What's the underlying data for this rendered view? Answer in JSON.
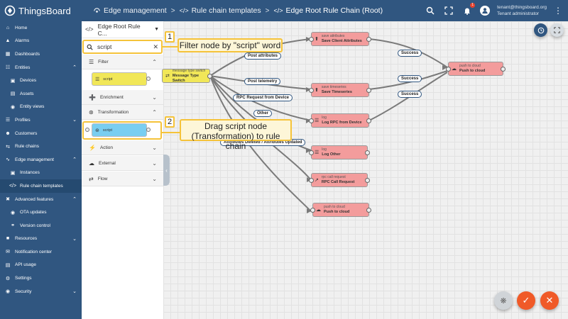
{
  "header": {
    "app_name": "ThingsBoard",
    "breadcrumbs": [
      {
        "label": "Edge management"
      },
      {
        "label": "Rule chain templates"
      },
      {
        "label": "Edge Root Rule Chain (Root)"
      }
    ],
    "notification_count": "1",
    "user_email": "tenant@thingsboard.org",
    "user_role": "Tenant administrator"
  },
  "sidebar": {
    "items": [
      {
        "label": "Home",
        "icon": "home-icon"
      },
      {
        "label": "Alarms",
        "icon": "alarm-icon"
      },
      {
        "label": "Dashboards",
        "icon": "dashboard-icon"
      },
      {
        "label": "Entities",
        "icon": "entities-icon",
        "expanded": true
      },
      {
        "label": "Devices",
        "icon": "device-icon",
        "sub": true
      },
      {
        "label": "Assets",
        "icon": "asset-icon",
        "sub": true
      },
      {
        "label": "Entity views",
        "icon": "entity-view-icon",
        "sub": true
      },
      {
        "label": "Profiles",
        "icon": "profile-icon"
      },
      {
        "label": "Customers",
        "icon": "customers-icon"
      },
      {
        "label": "Rule chains",
        "icon": "rule-chain-icon"
      },
      {
        "label": "Edge management",
        "icon": "edge-icon",
        "expanded": true
      },
      {
        "label": "Instances",
        "icon": "instances-icon",
        "sub": true
      },
      {
        "label": "Rule chain templates",
        "icon": "template-icon",
        "sub": true,
        "active": true
      },
      {
        "label": "Advanced features",
        "icon": "advanced-icon",
        "expanded": true
      },
      {
        "label": "OTA updates",
        "icon": "ota-icon",
        "sub": true
      },
      {
        "label": "Version control",
        "icon": "version-control-icon",
        "sub": true
      },
      {
        "label": "Resources",
        "icon": "resources-icon"
      },
      {
        "label": "Notification center",
        "icon": "notification-icon"
      },
      {
        "label": "API usage",
        "icon": "api-usage-icon"
      },
      {
        "label": "Settings",
        "icon": "settings-icon"
      },
      {
        "label": "Security",
        "icon": "security-icon"
      }
    ]
  },
  "library": {
    "rule_chain_select": "Edge Root Rule C...",
    "search_value": "script",
    "categories": {
      "filter": "Filter",
      "enrichment": "Enrichment",
      "transformation": "Transformation",
      "action": "Action",
      "external": "External",
      "flow": "Flow"
    },
    "filter_node": "script",
    "transformation_node": "script"
  },
  "callouts": {
    "one_number": "1",
    "one_text": "Filter node by \"script\" word",
    "two_number": "2",
    "two_text": "Drag script node (Transformation) to rule chain"
  },
  "canvas": {
    "nodes": {
      "switch": {
        "type": "message type switch",
        "name": "Message Type Switch"
      },
      "save_attr": {
        "type": "save attributes",
        "name": "Save Client Attributes"
      },
      "save_ts": {
        "type": "save timeseries",
        "name": "Save Timeseries"
      },
      "log_rpc": {
        "type": "log",
        "name": "Log RPC from Device"
      },
      "log_other": {
        "type": "log",
        "name": "Log Other"
      },
      "rpc_call": {
        "type": "rpc call request",
        "name": "RPC Call Request"
      },
      "push_bottom": {
        "type": "push to cloud",
        "name": "Push to cloud"
      },
      "push_right": {
        "type": "push to cloud",
        "name": "Push to cloud"
      }
    },
    "labels": {
      "post_attributes": "Post attributes",
      "post_telemetry": "Post telemetry",
      "rpc_request": "RPC Request from Device",
      "other": "Other",
      "attributes_deleted": "Attributes Deleted / Attributes Updated",
      "success_1": "Success",
      "success_2": "Success",
      "success_3": "Success"
    }
  },
  "colors": {
    "topbar": "#305680",
    "highlight": "#f5c33a",
    "node_red": "#f39c9c",
    "node_yellow": "#f1e758",
    "node_blue": "#79cef1",
    "fab_orange": "#f05a28"
  }
}
